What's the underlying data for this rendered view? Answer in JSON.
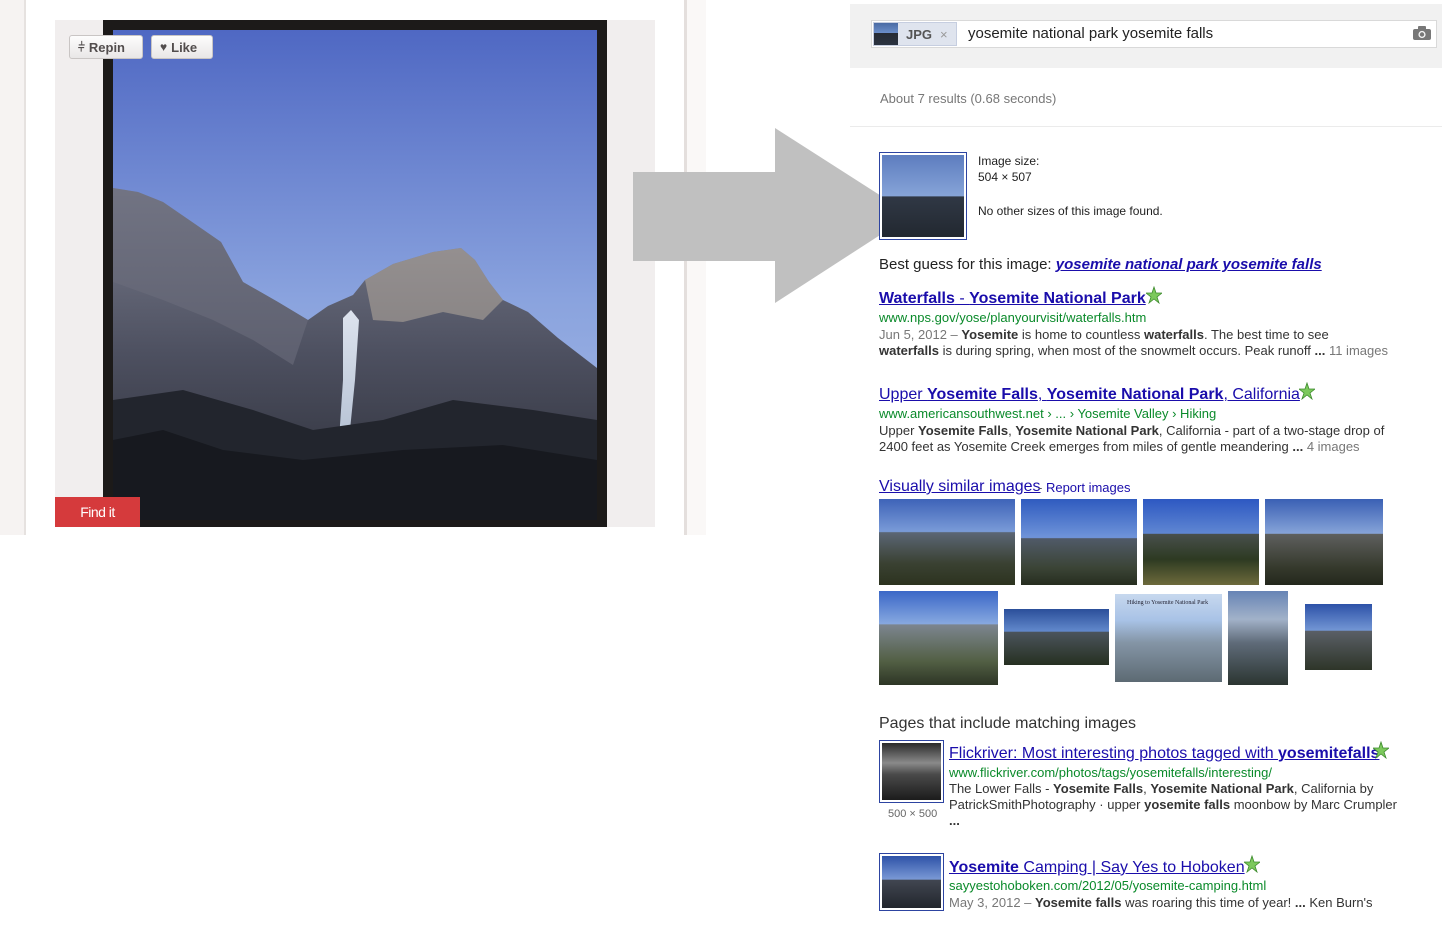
{
  "pin": {
    "repin_label": "Repin",
    "like_label": "Like",
    "find_it_label": "Find it",
    "repin_icon": "pushpin-icon",
    "like_icon": "heart-icon"
  },
  "search": {
    "chip_label": "JPG",
    "chip_close": "×",
    "query": "yosemite national park yosemite falls",
    "camera_icon": "camera-icon"
  },
  "stats": "About 7 results (0.68 seconds)",
  "query_image": {
    "size_label": "Image size:",
    "size_value": "504 × 507",
    "no_other_sizes": "No other sizes of this image found."
  },
  "best_guess": {
    "prefix": "Best guess for this image:",
    "link": "yosemite national park yosemite falls"
  },
  "results": [
    {
      "title_parts": [
        "Waterfalls",
        " - ",
        "Yosemite National Park"
      ],
      "url": "www.nps.gov/yose/planyourvisit/waterfalls.htm",
      "date": "Jun 5, 2012 –",
      "snippet_line1_a": "Yosemite",
      "snippet_line1_b": " is home to countless ",
      "snippet_line1_c": "waterfalls",
      "snippet_line1_d": ". The best time to see",
      "snippet_line2_a": "waterfalls",
      "snippet_line2_b": " is during spring, when most of the snowmelt occurs. Peak runoff ",
      "snippet_line2_c": "...",
      "images_count": "11 images"
    },
    {
      "title_a": "Upper ",
      "title_b": "Yosemite Falls",
      "title_c": ", ",
      "title_d": "Yosemite National Park",
      "title_e": ", California",
      "url": "www.americansouthwest.net › ... › Yosemite Valley › Hiking",
      "snippet_line1_a": "Upper ",
      "snippet_line1_b": "Yosemite Falls",
      "snippet_line1_c": ", ",
      "snippet_line1_d": "Yosemite National Park",
      "snippet_line1_e": ", California - part of a two-stage drop of",
      "snippet_line2_a": "2400 feet as Yosemite Creek emerges from miles of gentle meandering ",
      "snippet_line2_b": "...",
      "images_count": "4 images"
    }
  ],
  "similar": {
    "link": "Visually similar images",
    "dash": " - ",
    "report": "Report images"
  },
  "pages_heading": "Pages that include matching images",
  "pages": [
    {
      "title_a": "Flickriver: Most interesting photos tagged with ",
      "title_b": "yosemitefalls",
      "url": "www.flickriver.com/photos/tags/yosemitefalls/interesting/",
      "thumb_size": "500 × 500",
      "snippet_line1_a": "The Lower Falls - ",
      "snippet_line1_b": "Yosemite Falls",
      "snippet_line1_c": ", ",
      "snippet_line1_d": "Yosemite National Park",
      "snippet_line1_e": ", California by",
      "snippet_line2_a": "PatrickSmithPhotography · upper ",
      "snippet_line2_b": "yosemite falls",
      "snippet_line2_c": " moonbow by Marc Crumpler",
      "snippet_line3": "..."
    },
    {
      "title_a": "Yosemite",
      "title_b": " Camping | Say Yes to Hoboken",
      "url": "sayyestohoboken.com/2012/05/yosemite-camping.html",
      "date": "May 3, 2012 –",
      "snippet_a": "Yosemite falls",
      "snippet_b": " was roaring this time of year! ",
      "snippet_c": "...",
      "snippet_d": " Ken Burn's"
    }
  ],
  "similar_thumb_caption": "Hiking to Yosemite National Park",
  "colors": {
    "link": "#1a0dab",
    "url_green": "#0a8a2a",
    "find_it_red": "#d53a3c",
    "arrow_gray": "#c0c0c0"
  }
}
